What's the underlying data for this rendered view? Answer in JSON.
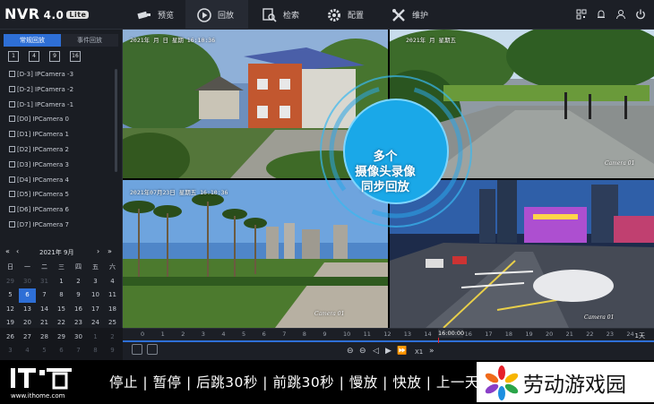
{
  "header": {
    "brand": "NVR",
    "version": "4.0",
    "edition": "Lite",
    "nav": [
      {
        "label": "预览",
        "icon": "camera-icon"
      },
      {
        "label": "回放",
        "icon": "playback-icon"
      },
      {
        "label": "检索",
        "icon": "search-icon"
      },
      {
        "label": "配置",
        "icon": "gear-icon"
      },
      {
        "label": "维护",
        "icon": "tools-icon"
      }
    ]
  },
  "sidebar": {
    "tabs": [
      "常规回放",
      "事件回放"
    ],
    "grid_options": [
      "1",
      "4",
      "9",
      "16"
    ],
    "cameras": [
      "[D-3] IPCamera -3",
      "[D-2] IPCamera -2",
      "[D-1] IPCamera -1",
      "[D0] IPCamera 0",
      "[D1] IPCamera 1",
      "[D2] IPCamera 2",
      "[D3] IPCamera 3",
      "[D4] IPCamera 4",
      "[D5] IPCamera 5",
      "[D6] IPCamera 6",
      "[D7] IPCamera 7"
    ]
  },
  "calendar": {
    "month_label": "2021年 9月",
    "prev_year": "«",
    "prev_month": "‹",
    "next_month": "›",
    "next_year": "»",
    "weekdays": [
      "日",
      "一",
      "二",
      "三",
      "四",
      "五",
      "六"
    ],
    "weeks": [
      [
        "29",
        "30",
        "31",
        "1",
        "2",
        "3",
        "4"
      ],
      [
        "5",
        "6",
        "7",
        "8",
        "9",
        "10",
        "11"
      ],
      [
        "12",
        "13",
        "14",
        "15",
        "16",
        "17",
        "18"
      ],
      [
        "19",
        "20",
        "21",
        "22",
        "23",
        "24",
        "25"
      ],
      [
        "26",
        "27",
        "28",
        "29",
        "30",
        "1",
        "2"
      ],
      [
        "3",
        "4",
        "5",
        "6",
        "7",
        "8",
        "9"
      ]
    ],
    "selected": "6"
  },
  "video": {
    "tiles": [
      {
        "timestamp": "2021年 月 日 星期 16:10:36",
        "label": "",
        "scene": "house"
      },
      {
        "timestamp": "2021年 月 星期五",
        "label": "Camera 01",
        "scene": "plaza"
      },
      {
        "timestamp": "2021年07月23日 星期五 16:10:36",
        "label": "Camera 01",
        "scene": "park"
      },
      {
        "timestamp": "",
        "label": "Camera 01",
        "scene": "street"
      }
    ],
    "overlay_lines": [
      "多个",
      "摄像头录像",
      "同步回放"
    ]
  },
  "timeline": {
    "hours": [
      "0",
      "1",
      "2",
      "3",
      "4",
      "5",
      "6",
      "7",
      "8",
      "9",
      "10",
      "11",
      "12",
      "13",
      "14",
      "15",
      "16",
      "17",
      "18",
      "19",
      "20",
      "21",
      "22",
      "23",
      "24"
    ],
    "current_time": "16:00:00",
    "speed": "X1",
    "range": "1天"
  },
  "caption": {
    "source_url": "www.ithome.com",
    "text": "停止 | 暂停 | 后跳30秒 | 前跳30秒 | 慢放 | 快放 | 上一天",
    "watermark": "劳动游戏园"
  },
  "colors": {
    "accent": "#2e6fd6",
    "overlay": "#1aa8e8",
    "panel": "#1a1d23"
  }
}
